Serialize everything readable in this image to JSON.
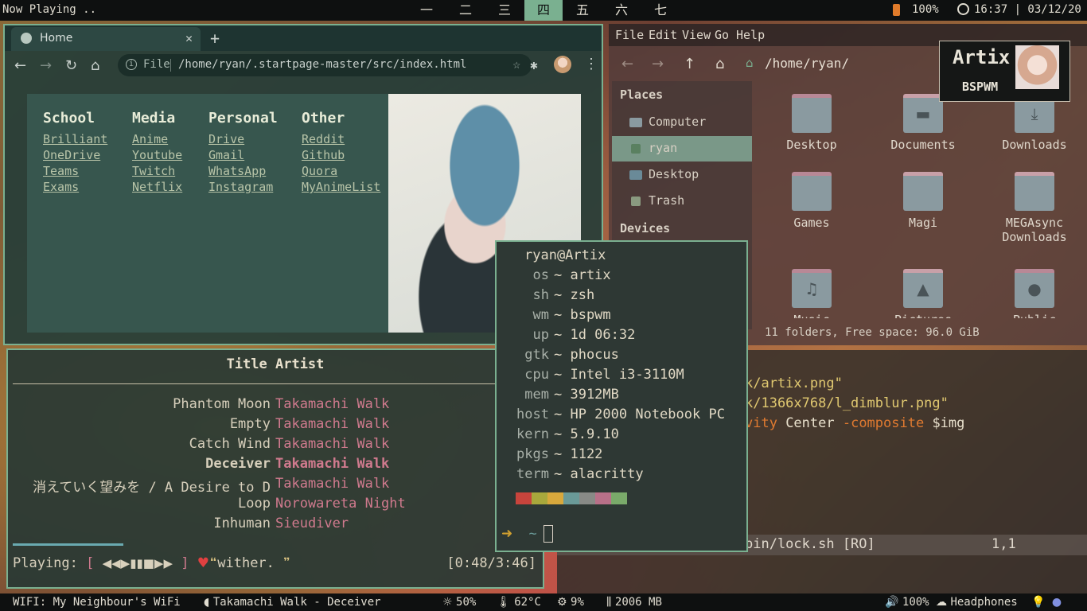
{
  "topbar": {
    "now_playing": "Now Playing ..",
    "workspaces": [
      "一",
      "二",
      "三",
      "四",
      "五",
      "六",
      "七"
    ],
    "active_workspace": "四",
    "battery": "100%",
    "clock": "16:37 | 03/12/20"
  },
  "browser": {
    "tab_title": "Home",
    "tab_close": "✕",
    "new_tab": "+",
    "url_label": "File",
    "url_path": "/home/ryan/.startpage-master/src/index.html",
    "nav": {
      "back": "←",
      "forward": "→",
      "reload": "↻",
      "home": "⌂",
      "star": "☆",
      "extensions": "✱",
      "menu": "⋮"
    },
    "columns": [
      {
        "title": "School",
        "links": [
          "Brilliant",
          "OneDrive",
          "Teams",
          "Exams"
        ]
      },
      {
        "title": "Media",
        "links": [
          "Anime",
          "Youtube",
          "Twitch",
          "Netflix"
        ]
      },
      {
        "title": "Personal",
        "links": [
          "Drive",
          "Gmail",
          "WhatsApp",
          "Instagram"
        ]
      },
      {
        "title": "Other",
        "links": [
          "Reddit",
          "Github",
          "Quora",
          "MyAnimeList"
        ]
      }
    ]
  },
  "filemanager": {
    "menu": [
      "File",
      "Edit",
      "View",
      "Go",
      "Help"
    ],
    "location": "/home/ryan/",
    "sidebar": {
      "places_header": "Places",
      "places": [
        "Computer",
        "ryan",
        "Desktop",
        "Trash"
      ],
      "selected": "ryan",
      "devices_header": "Devices"
    },
    "folders": [
      {
        "name": "Desktop",
        "glyph": ""
      },
      {
        "name": "Documents",
        "glyph": "▬"
      },
      {
        "name": "Downloads",
        "glyph": "⤓"
      },
      {
        "name": "Games",
        "glyph": ""
      },
      {
        "name": "Magi",
        "glyph": ""
      },
      {
        "name": "MEGAsync\nDownloads",
        "glyph": ""
      },
      {
        "name": "Music",
        "glyph": "♫"
      },
      {
        "name": "Pictures",
        "glyph": "▲"
      },
      {
        "name": "Public",
        "glyph": "●"
      }
    ],
    "status": "11 folders, Free space: 96.0 GiB"
  },
  "notification": {
    "title": "Artix",
    "subtitle": "BSPWM"
  },
  "player": {
    "header": "Title Artist",
    "tracks": [
      {
        "title": "Phantom Moon",
        "artist": "Takamachi Walk"
      },
      {
        "title": "Empty",
        "artist": "Takamachi Walk"
      },
      {
        "title": "Catch Wind",
        "artist": "Takamachi Walk"
      },
      {
        "title": "Deceiver",
        "artist": "Takamachi Walk"
      },
      {
        "title": "消えていく望みを / A Desire to D",
        "artist": "Takamachi Walk"
      },
      {
        "title": "Loop",
        "artist": "Norowareta Night"
      },
      {
        "title": "Inhuman",
        "artist": "Sieudiver"
      }
    ],
    "current_index": 3,
    "progress_fraction": 0.21,
    "playing_label": "Playing:",
    "controls": "◀◀▶▮▮■▶▶",
    "lyric": "wither.",
    "time": "[0:48/3:46]"
  },
  "editor": {
    "lines": [
      {
        "a": "k/artix.png\"",
        "kind": "yel"
      },
      {
        "a": "k/1366x768/l_dimblur.png\"",
        "kind": "yel"
      },
      {
        "a": "vity",
        "b": " Center ",
        "c": "-composite ",
        "d": "$img",
        "kind": "mix"
      }
    ],
    "status_file": "bin/lock.sh [RO]",
    "status_pos": "1,1"
  },
  "terminal": {
    "user_host": "ryan@Artix",
    "info": [
      {
        "k": "os",
        "v": "~ artix"
      },
      {
        "k": "sh",
        "v": "~ zsh"
      },
      {
        "k": "wm",
        "v": "~ bspwm"
      },
      {
        "k": "up",
        "v": "~ 1d 06:32"
      },
      {
        "k": "gtk",
        "v": "~ phocus"
      },
      {
        "k": "cpu",
        "v": "~ Intel i3-3110M"
      },
      {
        "k": "mem",
        "v": "~ 3912MB"
      },
      {
        "k": "host",
        "v": "~ HP 2000 Notebook PC"
      },
      {
        "k": "kern",
        "v": "~ 5.9.10"
      },
      {
        "k": "pkgs",
        "v": "~ 1122"
      },
      {
        "k": "term",
        "v": "~ alacritty"
      }
    ],
    "palette": [
      "#c8443c",
      "#a8a83c",
      "#d8a83c",
      "#6a9a98",
      "#888a86",
      "#b87088",
      "#7aaa6a"
    ],
    "prompt_arrow": "➜",
    "prompt_dir": "~"
  },
  "bottombar": {
    "wifi": "WIFI: My Neighbour's WiFi",
    "song": "Takamachi Walk - Deceiver",
    "brightness": "50%",
    "temperature": "62°C",
    "cpu": "9%",
    "ram": "2006 MB",
    "volume": "100%",
    "audio_device": "Headphones"
  }
}
